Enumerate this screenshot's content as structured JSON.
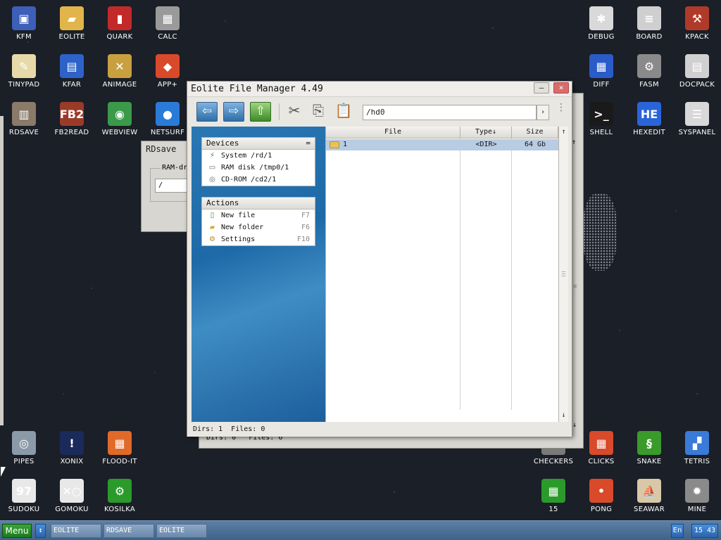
{
  "desktop": {
    "icons_left_top": [
      {
        "label": "KFM",
        "icon": "floppy-icon",
        "color": "#3d5fb8",
        "glyph": "▣"
      },
      {
        "label": "EOLITE",
        "icon": "folder-icon",
        "color": "#e2b54a",
        "glyph": "▰"
      },
      {
        "label": "QUARK",
        "icon": "book-icon",
        "color": "#c22a2a",
        "glyph": "▮"
      },
      {
        "label": "CALC",
        "icon": "calculator-icon",
        "color": "#9a9a9a",
        "glyph": "▦"
      },
      {
        "label": "TINYPAD",
        "icon": "notepad-icon",
        "color": "#e8d9a8",
        "glyph": "✎"
      },
      {
        "label": "KFAR",
        "icon": "archive-icon",
        "color": "#2d63c9",
        "glyph": "▤"
      },
      {
        "label": "ANIMAGE",
        "icon": "brush-icon",
        "color": "#c9a040",
        "glyph": "✕"
      },
      {
        "label": "APP+",
        "icon": "cube-icon",
        "color": "#d84a2a",
        "glyph": "◆"
      },
      {
        "label": "RDSAVE",
        "icon": "disk-save-icon",
        "color": "#8a7a6a",
        "glyph": "▥"
      },
      {
        "label": "FB2READ",
        "icon": "fb2-book-icon",
        "color": "#9a3b2a",
        "glyph": "FB2"
      },
      {
        "label": "WEBVIEW",
        "icon": "globe-page-icon",
        "color": "#3a9a4a",
        "glyph": "◉"
      },
      {
        "label": "NETSURF",
        "icon": "globe-icon",
        "color": "#2a7bd8",
        "glyph": "●"
      }
    ],
    "icons_right_top": [
      {
        "label": "DEBUG",
        "icon": "bug-window-icon",
        "color": "#d9d9d9",
        "glyph": "✱"
      },
      {
        "label": "BOARD",
        "icon": "board-window-icon",
        "color": "#cfcfcf",
        "glyph": "≡"
      },
      {
        "label": "KPACK",
        "icon": "hammer-icon",
        "color": "#b03a2a",
        "glyph": "⚒"
      },
      {
        "label": "DIFF",
        "icon": "diff-icon",
        "color": "#2a5bc9",
        "glyph": "▦"
      },
      {
        "label": "FASM",
        "icon": "fasm-icon",
        "color": "#8a8a8a",
        "glyph": "⚙"
      },
      {
        "label": "DOCPACK",
        "icon": "cabinet-icon",
        "color": "#d0d0d0",
        "glyph": "▤"
      },
      {
        "label": "SHELL",
        "icon": "terminal-icon",
        "color": "#1a1a1a",
        "glyph": ">_"
      },
      {
        "label": "HEXEDIT",
        "icon": "hex-icon",
        "color": "#2a64d8",
        "glyph": "HE"
      },
      {
        "label": "SYSPANEL",
        "icon": "sliders-icon",
        "color": "#d8d8d8",
        "glyph": "☰"
      }
    ],
    "icons_left_bottom": [
      {
        "label": "PIPES",
        "icon": "pipes-icon",
        "color": "#8a9aa8",
        "glyph": "◎"
      },
      {
        "label": "XONIX",
        "icon": "xonix-icon",
        "color": "#1a2a5a",
        "glyph": "!"
      },
      {
        "label": "FLOOD-IT",
        "icon": "flood-icon",
        "color": "#e06a2a",
        "glyph": "▦"
      },
      {
        "label": "SUDOKU",
        "icon": "sudoku-icon",
        "color": "#e8e8e8",
        "glyph": "97"
      },
      {
        "label": "GOMOKU",
        "icon": "gomoku-icon",
        "color": "#e8e8e8",
        "glyph": "✕○"
      },
      {
        "label": "KOSILKA",
        "icon": "lawnmower-icon",
        "color": "#2a9a2a",
        "glyph": "⚙"
      }
    ],
    "icons_right_bottom": [
      {
        "label": "CHECKERS",
        "icon": "checkers-icon",
        "color": "#7a7a7a",
        "glyph": "●"
      },
      {
        "label": "CLICKS",
        "icon": "clicks-icon",
        "color": "#d84a2a",
        "glyph": "▦"
      },
      {
        "label": "SNAKE",
        "icon": "snake-icon",
        "color": "#3a9a2a",
        "glyph": "§"
      },
      {
        "label": "TETRIS",
        "icon": "tetris-icon",
        "color": "#3a7ad8",
        "glyph": "▞"
      },
      {
        "label": "15",
        "icon": "fifteen-icon",
        "color": "#2a9a2a",
        "glyph": "▦"
      },
      {
        "label": "PONG",
        "icon": "pong-icon",
        "color": "#d84a2a",
        "glyph": "•"
      },
      {
        "label": "SEAWAR",
        "icon": "ship-icon",
        "color": "#d8c8a8",
        "glyph": "⛵"
      },
      {
        "label": "MINE",
        "icon": "mine-icon",
        "color": "#8a8a8a",
        "glyph": "✹"
      }
    ]
  },
  "rdsave": {
    "title": "RDsave",
    "group_label": "RAM-dr",
    "input_value": "/"
  },
  "back_window": {
    "status": "Dirs: 0   Files: 6"
  },
  "window": {
    "title": "Eolite File Manager 4.49",
    "minimize": "–",
    "close": "×",
    "toolbar": {
      "back": "⇦",
      "forward": "⇨",
      "up": "⇧",
      "cut": "✂",
      "copy": "⎘",
      "paste": "📋",
      "path": "/hd0",
      "go": "›",
      "menu": "⋮"
    },
    "devices": {
      "title": "Devices",
      "toggle": "=",
      "items": [
        {
          "label": "System /rd/1",
          "icon": "ramdisk-system-icon",
          "glyph": "⚡"
        },
        {
          "label": "RAM disk /tmp0/1",
          "icon": "ram-icon",
          "glyph": "▭"
        },
        {
          "label": "CD-ROM /cd2/1",
          "icon": "cdrom-icon",
          "glyph": "◎"
        }
      ]
    },
    "actions": {
      "title": "Actions",
      "items": [
        {
          "label": "New file",
          "key": "F7",
          "icon": "new-file-icon",
          "glyph": "▯"
        },
        {
          "label": "New folder",
          "key": "F6",
          "icon": "new-folder-icon",
          "glyph": "▰"
        },
        {
          "label": "Settings",
          "key": "F10",
          "icon": "settings-icon",
          "glyph": "⚙"
        }
      ]
    },
    "columns": {
      "file": "File",
      "type": "Type↓",
      "size": "Size"
    },
    "files": [
      {
        "name": "1",
        "type": "<DIR>",
        "size": "64 Gb"
      }
    ],
    "scroll_up": "↑",
    "scroll_down": "↓",
    "status": "Dirs: 1  Files: 0"
  },
  "taskbar": {
    "menu": "Menu",
    "sort": "↕",
    "tasks": [
      "EOLITE",
      "RDSAVE",
      "EOLITE"
    ],
    "lang": "En",
    "clock": "15 43"
  }
}
